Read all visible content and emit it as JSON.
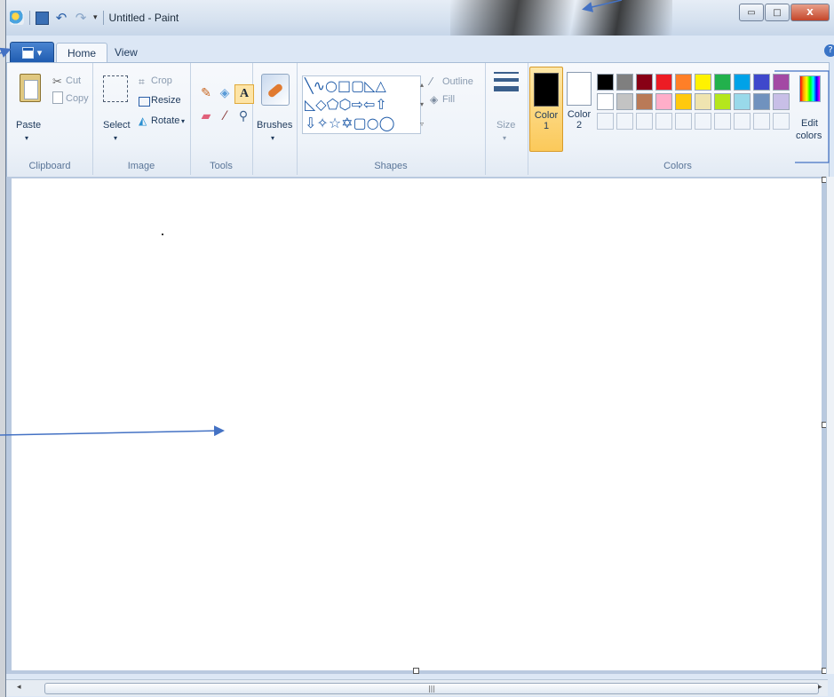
{
  "window": {
    "title": "Untitled - Paint",
    "minimize_label": "▭",
    "maximize_label": "□",
    "close_label": "X"
  },
  "qat": {
    "undo_glyph": "↶",
    "redo_glyph": "↷",
    "dropdown_glyph": "▾"
  },
  "tabs": {
    "menu_glyph": "▾",
    "home": "Home",
    "view": "View",
    "help_glyph": "?"
  },
  "clipboard": {
    "paste": "Paste",
    "cut": "Cut",
    "copy": "Copy",
    "group": "Clipboard"
  },
  "image": {
    "select": "Select",
    "crop": "Crop",
    "resize": "Resize",
    "rotate": "Rotate",
    "group": "Image"
  },
  "tools": {
    "group": "Tools",
    "text_glyph": "A"
  },
  "brushes": {
    "label": "Brushes"
  },
  "shapes": {
    "row1": "╲∿○□▢◺△",
    "row2": "◺◇⬠⬡⇨⇦⇧",
    "row3": "⇩✧☆✡▢○◯",
    "outline": "Outline",
    "fill": "Fill",
    "group": "Shapes"
  },
  "size": {
    "label": "Size"
  },
  "colors": {
    "color1_line1": "Color",
    "color1_line2": "1",
    "color2_line1": "Color",
    "color2_line2": "2",
    "edit_line1": "Edit",
    "edit_line2": "colors",
    "group": "Colors",
    "color1_value": "#000000",
    "color2_value": "#ffffff",
    "palette_row1": [
      "#000000",
      "#7f7f7f",
      "#880015",
      "#ed1c24",
      "#ff7f27",
      "#fff200",
      "#22b14c",
      "#00a2e8",
      "#3f48cc",
      "#a349a4"
    ],
    "palette_row2": [
      "#ffffff",
      "#c3c3c3",
      "#b97a57",
      "#ffaec9",
      "#ffc90e",
      "#efe4b0",
      "#b5e61d",
      "#99d9ea",
      "#7092be",
      "#c8bfe7"
    ]
  },
  "scroll": {
    "left_arrow": "◂",
    "right_arrow": "▸",
    "grip": "|||"
  }
}
